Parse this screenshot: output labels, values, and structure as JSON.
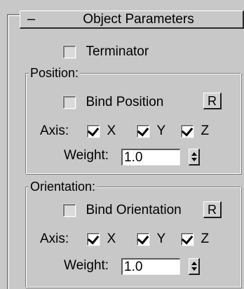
{
  "rollout": {
    "toggle_symbol": "–",
    "title": "Object Parameters"
  },
  "terminator": {
    "label": "Terminator",
    "checked": false
  },
  "position": {
    "group_title": "Position:",
    "bind_label": "Bind Position",
    "bind_checked": false,
    "reset_label": "R",
    "axis_label": "Axis:",
    "axes": [
      {
        "label": "X",
        "checked": true
      },
      {
        "label": "Y",
        "checked": true
      },
      {
        "label": "Z",
        "checked": true
      }
    ],
    "weight_label": "Weight:",
    "weight_value": "1.0"
  },
  "orientation": {
    "group_title": "Orientation:",
    "bind_label": "Bind Orientation",
    "bind_checked": false,
    "reset_label": "R",
    "axis_label": "Axis:",
    "axes": [
      {
        "label": "X",
        "checked": true
      },
      {
        "label": "Y",
        "checked": true
      },
      {
        "label": "Z",
        "checked": true
      }
    ],
    "weight_label": "Weight:",
    "weight_value": "1.0"
  }
}
